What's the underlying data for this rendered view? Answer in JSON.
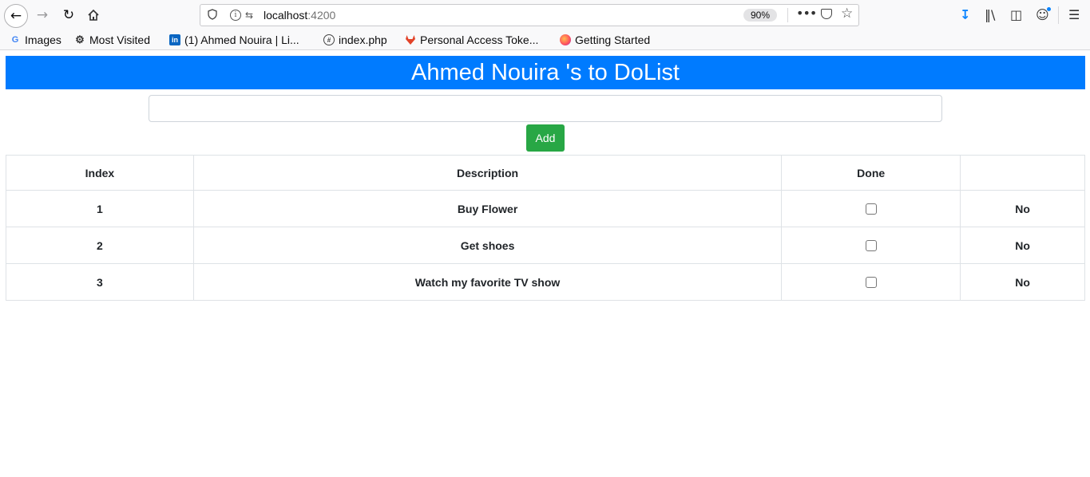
{
  "browser": {
    "url_host": "localhost",
    "url_port": ":4200",
    "zoom": "90%",
    "more_label": "•••",
    "bookmarks": [
      {
        "label": "Images",
        "icon": "google-icon"
      },
      {
        "label": "Most Visited",
        "icon": "gear-icon"
      },
      {
        "label": "(1) Ahmed Nouira | Li...",
        "icon": "linkedin-icon"
      },
      {
        "label": "index.php",
        "icon": "globe-icon"
      },
      {
        "label": "Personal Access Toke...",
        "icon": "gitlab-icon"
      },
      {
        "label": "Getting Started",
        "icon": "firefox-icon"
      }
    ]
  },
  "app": {
    "title": "Ahmed Nouira 's to DoList",
    "input": {
      "value": "",
      "placeholder": ""
    },
    "add_label": "Add",
    "table": {
      "headers": [
        "Index",
        "Description",
        "Done",
        ""
      ],
      "rows": [
        {
          "index": "1",
          "description": "Buy Flower",
          "done": false,
          "status": "No"
        },
        {
          "index": "2",
          "description": "Get shoes",
          "done": false,
          "status": "No"
        },
        {
          "index": "3",
          "description": "Watch my favorite TV show",
          "done": false,
          "status": "No"
        }
      ]
    }
  },
  "colors": {
    "header": "#007bff",
    "add_button": "#28a745"
  }
}
